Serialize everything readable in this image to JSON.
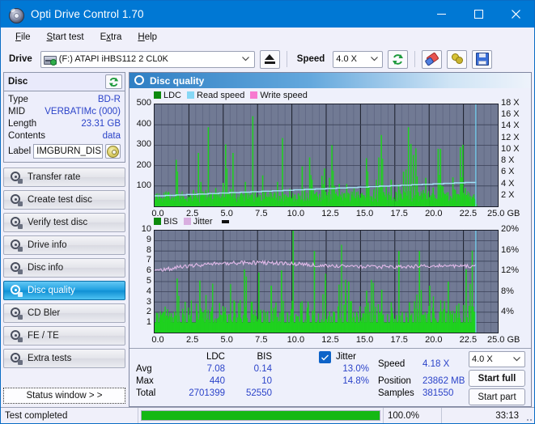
{
  "window": {
    "title": "Opti Drive Control 1.70",
    "icon": "disc-icon",
    "minimize": "minimize-icon",
    "maximize": "maximize-icon",
    "close": "close-icon"
  },
  "menu": [
    {
      "label": "File",
      "accel": "F"
    },
    {
      "label": "Start test",
      "accel": "S"
    },
    {
      "label": "Extra",
      "accel": "x"
    },
    {
      "label": "Help",
      "accel": "H"
    }
  ],
  "toolbar": {
    "drive_label": "Drive",
    "drive_value": "(F:)  ATAPI iHBS112  2 CL0K",
    "eject_icon": "eject-icon",
    "speed_label": "Speed",
    "speed_value": "4.0 X",
    "refresh_icon": "refresh-icon",
    "erase_icon": "eraser-icon",
    "keys_icon": "keys-icon",
    "save_icon": "save-floppy-icon"
  },
  "disc": {
    "title": "Disc",
    "refresh_icon": "refresh-icon",
    "rows": [
      {
        "key": "Type",
        "value": "BD-R"
      },
      {
        "key": "MID",
        "value": "VERBATIMc (000)"
      },
      {
        "key": "Length",
        "value": "23.31 GB"
      },
      {
        "key": "Contents",
        "value": "data"
      }
    ],
    "label_key": "Label",
    "label_value": "IMGBURN_DIS",
    "label_icon": "cd-icon"
  },
  "nav": {
    "items": [
      {
        "label": "Transfer rate",
        "icon": "disc-transfer-icon",
        "active": false
      },
      {
        "label": "Create test disc",
        "icon": "disc-create-icon",
        "active": false
      },
      {
        "label": "Verify test disc",
        "icon": "disc-verify-icon",
        "active": false
      },
      {
        "label": "Drive info",
        "icon": "disc-drive-icon",
        "active": false
      },
      {
        "label": "Disc info",
        "icon": "disc-info-icon",
        "active": false
      },
      {
        "label": "Disc quality",
        "icon": "disc-quality-icon",
        "active": true
      },
      {
        "label": "CD Bler",
        "icon": "disc-bler-icon",
        "active": false
      },
      {
        "label": "FE / TE",
        "icon": "disc-fete-icon",
        "active": false
      },
      {
        "label": "Extra tests",
        "icon": "disc-extra-icon",
        "active": false
      }
    ],
    "status_window": "Status window > >"
  },
  "panel": {
    "title": "Disc quality",
    "icon": "disc-quality-icon"
  },
  "chart_data": [
    {
      "type": "line",
      "id": "ldc-chart",
      "title": "",
      "xlabel": "GB",
      "ylabel": "",
      "xlim": [
        0,
        25
      ],
      "ylim": [
        0,
        500
      ],
      "y2lim": [
        0,
        18
      ],
      "y2label": "X",
      "grid": true,
      "legend_position": "top-left",
      "xticks": [
        "0.0",
        "2.5",
        "5.0",
        "7.5",
        "10.0",
        "12.5",
        "15.0",
        "17.5",
        "20.0",
        "22.5",
        "25.0"
      ],
      "yticks": [
        "100",
        "200",
        "300",
        "400",
        "500"
      ],
      "y2ticks": [
        "2 X",
        "4 X",
        "6 X",
        "8 X",
        "10 X",
        "12 X",
        "14 X",
        "16 X",
        "18 X"
      ],
      "xunit": "GB",
      "series": [
        {
          "name": "LDC",
          "color": "#1fd11f",
          "type": "bar"
        },
        {
          "name": "Read speed",
          "color": "#86d7f5",
          "type": "line"
        },
        {
          "name": "Write speed",
          "color": "#f77ad0",
          "type": "line"
        }
      ],
      "ldc_peaks": [
        60,
        35,
        42,
        30,
        55,
        70,
        38,
        45,
        228,
        60,
        30,
        48,
        38,
        25,
        30,
        80,
        55,
        262,
        120,
        45,
        80,
        388,
        60,
        35,
        90,
        52,
        40,
        115,
        304,
        60,
        85,
        262,
        40,
        30,
        55,
        60,
        120,
        36,
        44,
        442,
        72,
        40,
        55,
        152,
        68,
        44,
        80,
        40,
        66,
        120,
        52,
        335,
        60,
        44,
        86,
        40,
        58,
        34,
        50,
        196,
        88,
        44,
        240,
        130,
        60,
        45,
        60,
        150,
        186,
        56,
        140,
        300,
        100,
        55,
        110,
        44,
        64,
        110,
        62,
        44,
        88,
        70,
        42,
        60,
        40,
        236,
        100,
        50,
        84,
        130,
        240,
        350,
        70,
        102,
        60,
        130,
        44,
        70,
        108,
        62,
        170,
        180,
        388,
        306,
        252,
        284,
        70,
        54,
        80,
        140,
        66,
        50,
        92,
        40,
        282,
        282,
        98,
        60,
        70,
        50,
        142,
        80,
        60,
        290,
        302,
        90,
        60,
        50,
        44,
        35
      ],
      "read_speed_line": [
        1.9,
        2.0,
        2.1,
        2.2,
        2.3,
        2.4,
        2.5,
        2.6,
        2.7,
        2.8,
        2.9,
        3.0,
        3.1,
        3.2,
        3.3,
        3.4,
        3.5,
        3.6,
        3.7,
        3.8,
        3.9,
        4.0,
        4.1,
        4.2,
        4.3
      ]
    },
    {
      "type": "line",
      "id": "bis-chart",
      "title": "",
      "xlabel": "GB",
      "ylabel": "",
      "xlim": [
        0,
        25
      ],
      "ylim": [
        0,
        10
      ],
      "y2lim": [
        0,
        20
      ],
      "y2label": "%",
      "grid": true,
      "legend_position": "top-left",
      "xticks": [
        "0.0",
        "2.5",
        "5.0",
        "7.5",
        "10.0",
        "12.5",
        "15.0",
        "17.5",
        "20.0",
        "22.5",
        "25.0"
      ],
      "yticks": [
        "1",
        "2",
        "3",
        "4",
        "5",
        "6",
        "7",
        "8",
        "9",
        "10"
      ],
      "y2ticks": [
        "4%",
        "8%",
        "12%",
        "16%",
        "20%"
      ],
      "xunit": "GB",
      "series": [
        {
          "name": "BIS",
          "color": "#1fd11f",
          "type": "bar"
        },
        {
          "name": "Jitter",
          "color": "#d9aee0",
          "type": "line"
        }
      ],
      "jitter_avg_pct": 13.0,
      "jitter_max_pct": 14.8
    }
  ],
  "stats": {
    "headers": {
      "ldc": "LDC",
      "bis": "BIS"
    },
    "rows": [
      {
        "key": "Avg",
        "ldc": "7.08",
        "bis": "0.14",
        "jitter": "13.0%"
      },
      {
        "key": "Max",
        "ldc": "440",
        "bis": "10",
        "jitter": "14.8%"
      },
      {
        "key": "Total",
        "ldc": "2701399",
        "bis": "52550",
        "jitter": ""
      }
    ],
    "jitter_label": "Jitter",
    "jitter_checked": true,
    "speed_key": "Speed",
    "speed_value": "4.18 X",
    "position_key": "Position",
    "position_value": "23862 MB",
    "samples_key": "Samples",
    "samples_value": "381550",
    "speed_select": "4.0 X",
    "start_full": "Start full",
    "start_part": "Start part"
  },
  "statusbar": {
    "message": "Test completed",
    "progress_pct": 100,
    "progress_text": "100.0%",
    "elapsed": "33:13"
  },
  "colors": {
    "accent": "#0078d4",
    "plot_bg": "#717a94",
    "green": "#1fd11f",
    "read_speed": "#86d7f5",
    "write_speed": "#f77ad0",
    "jitter": "#d9aee0",
    "value_text": "#2b43c9",
    "progress": "#14b814"
  }
}
